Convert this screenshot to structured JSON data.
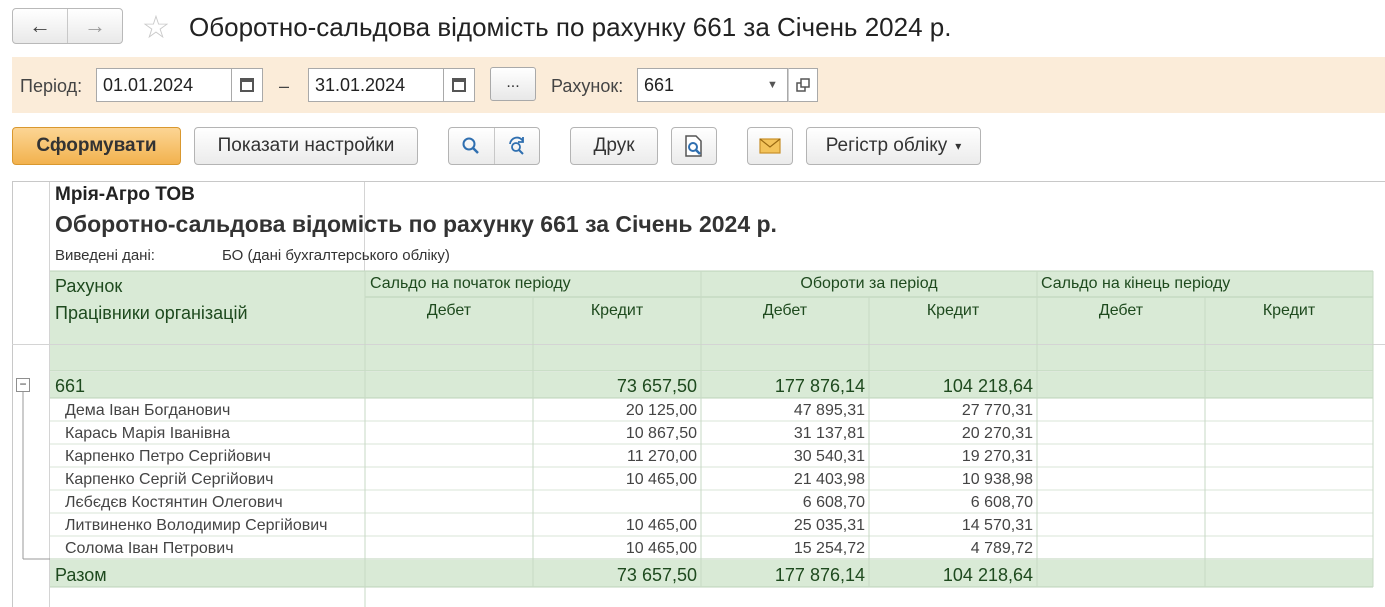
{
  "window": {
    "title": "Оборотно-сальдова відомість по рахунку 661 за Січень 2024 р.",
    "back_icon": "←",
    "forward_icon": "→",
    "star_icon": "☆"
  },
  "filter": {
    "period_label": "Період:",
    "date_from": "01.01.2024",
    "dash": "–",
    "date_to": "31.01.2024",
    "dots_label": "...",
    "account_label": "Рахунок:",
    "account_value": "661"
  },
  "toolbar": {
    "form_label": "Сформувати",
    "settings_label": "Показати настройки",
    "print_label": "Друк",
    "register_label": "Регістр обліку",
    "register_arrow": "▾"
  },
  "report": {
    "organization": "Мрія-Агро ТОВ",
    "title": "Оборотно-сальдова відомість по рахунку 661 за Січень 2024 р.",
    "data_mode_label": "Виведені дані:",
    "data_mode_value": "БО (дані бухгалтерського обліку)",
    "header": {
      "account": "Рахунок",
      "employees": "Працівники організацій",
      "opening": "Сальдо на початок періоду",
      "turnover": "Обороти за період",
      "closing": "Сальдо на кінець періоду",
      "debit": "Дебет",
      "credit": "Кредит"
    },
    "group": {
      "name": "661",
      "collapse_icon": "−",
      "opening_credit": "73 657,50",
      "turnover_debit": "177 876,14",
      "turnover_credit": "104 218,64"
    },
    "rows": [
      {
        "name": "Дема Іван Богданович",
        "opening_credit": "20 125,00",
        "turnover_debit": "47 895,31",
        "turnover_credit": "27 770,31"
      },
      {
        "name": "Карась Марія Іванівна",
        "opening_credit": "10 867,50",
        "turnover_debit": "31 137,81",
        "turnover_credit": "20 270,31"
      },
      {
        "name": "Карпенко Петро Сергійович",
        "opening_credit": "11 270,00",
        "turnover_debit": "30 540,31",
        "turnover_credit": "19 270,31"
      },
      {
        "name": "Карпенко Сергій Сергійович",
        "opening_credit": "10 465,00",
        "turnover_debit": "21 403,98",
        "turnover_credit": "10 938,98"
      },
      {
        "name": "Лєбєдєв Костянтин Олегович",
        "opening_credit": "",
        "turnover_debit": "6 608,70",
        "turnover_credit": "6 608,70"
      },
      {
        "name": "Литвиненко Володимир Сергійович",
        "opening_credit": "10 465,00",
        "turnover_debit": "25 035,31",
        "turnover_credit": "14 570,31"
      },
      {
        "name": "Солома Іван Петрович",
        "opening_credit": "10 465,00",
        "turnover_debit": "15 254,72",
        "turnover_credit": "4 789,72"
      }
    ],
    "total": {
      "label": "Разом",
      "opening_credit": "73 657,50",
      "turnover_debit": "177 876,14",
      "turnover_credit": "104 218,64"
    }
  }
}
